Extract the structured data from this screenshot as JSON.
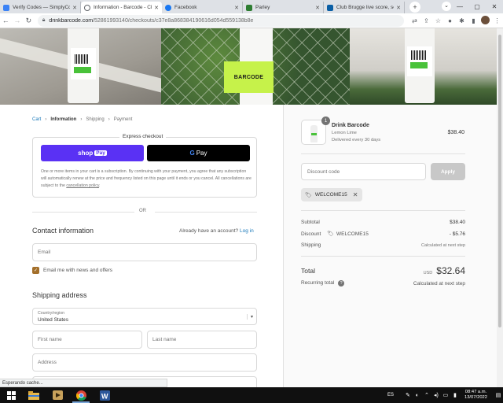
{
  "browser": {
    "tabs": [
      {
        "title": "Verify Codes — SimplyCod",
        "color": "#3b82f6"
      },
      {
        "title": "Information - Barcode - Ch",
        "color": "#5f6368",
        "active": true
      },
      {
        "title": "Facebook",
        "color": "#1877f2"
      },
      {
        "title": "Parley",
        "color": "#2e7d32"
      },
      {
        "title": "Club Brugge live score, sch",
        "color": "#0b5fa5"
      }
    ],
    "url_domain": "drinkbarcode.com",
    "url_path": "/52861993140/checkouts/c37e8a868384190616d054d559138b8e"
  },
  "hero": {
    "card_label": "BARCODE"
  },
  "breadcrumbs": {
    "cart": "Cart",
    "information": "Information",
    "shipping": "Shipping",
    "payment": "Payment",
    "separator": ">"
  },
  "express": {
    "legend": "Express checkout",
    "shop_label": "shop",
    "shop_pay": "Pay",
    "gpay_g": "G",
    "gpay_label": "Pay",
    "note": "One or more items in your cart is a subscription. By continuing with your payment, you agree that any subscription will automatically renew at the price and frequency listed on this page until it ends or you cancel. All cancellations are subject to the",
    "policy_link": "cancellation policy",
    "note_end": "."
  },
  "or_label": "OR",
  "contact": {
    "title": "Contact information",
    "account_prompt": "Already have an account?",
    "login_link": "Log in",
    "email_placeholder": "Email",
    "newsletter_label": "Email me with news and offers"
  },
  "shipping": {
    "title": "Shipping address",
    "country_label": "Country/region",
    "country_value": "United States",
    "first_name_placeholder": "First name",
    "last_name_placeholder": "Last name",
    "address_placeholder": "Address"
  },
  "summary": {
    "product": {
      "quantity": "1",
      "name": "Drink Barcode",
      "variant": "Lemon Lime",
      "schedule": "Delivered every 30 days",
      "price": "$38.40"
    },
    "discount_placeholder": "Discount code",
    "apply_label": "Apply",
    "applied_code": "WELCOME15",
    "subtotal_label": "Subtotal",
    "subtotal_value": "$38.40",
    "discount_label": "Discount",
    "discount_code": "WELCOME15",
    "discount_value": "- $5.76",
    "shipping_label": "Shipping",
    "shipping_value": "Calculated at next step",
    "total_label": "Total",
    "total_currency": "USD",
    "total_value": "$32.64",
    "recurring_label": "Recurring total",
    "recurring_value": "Calculated at next step"
  },
  "status_text": "Esperando cache...",
  "taskbar": {
    "language": "ES",
    "time": "08:47 a.m.",
    "date": "13/07/2022"
  }
}
